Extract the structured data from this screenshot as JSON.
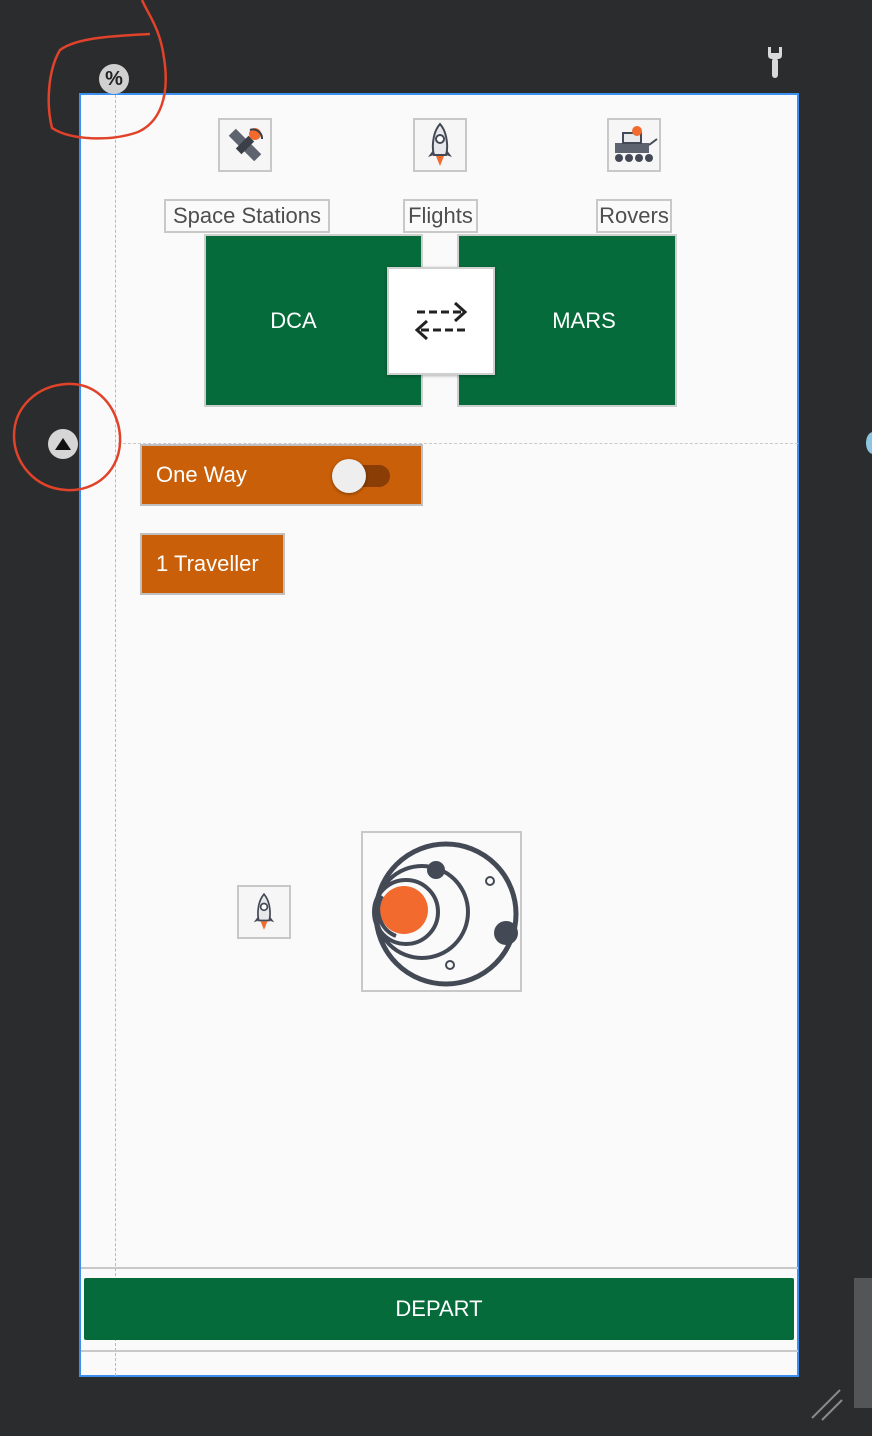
{
  "tabs": [
    {
      "label": "Space Stations",
      "icon": "satellite-icon"
    },
    {
      "label": "Flights",
      "icon": "rocket-icon"
    },
    {
      "label": "Rovers",
      "icon": "rover-icon"
    }
  ],
  "route": {
    "from": "DCA",
    "to": "MARS",
    "swap_icon": "swap-arrows-icon"
  },
  "trip_type": {
    "label": "One Way",
    "enabled": false
  },
  "travellers": {
    "label": "1 Traveller"
  },
  "depart": {
    "label": "DEPART"
  },
  "editor": {
    "percent_handle": "%",
    "tool_icon": "wrench-icon"
  },
  "colors": {
    "primary": "#066b3a",
    "accent": "#c95f08",
    "planet": "#f26a2e",
    "selection": "#3b8ff0"
  }
}
